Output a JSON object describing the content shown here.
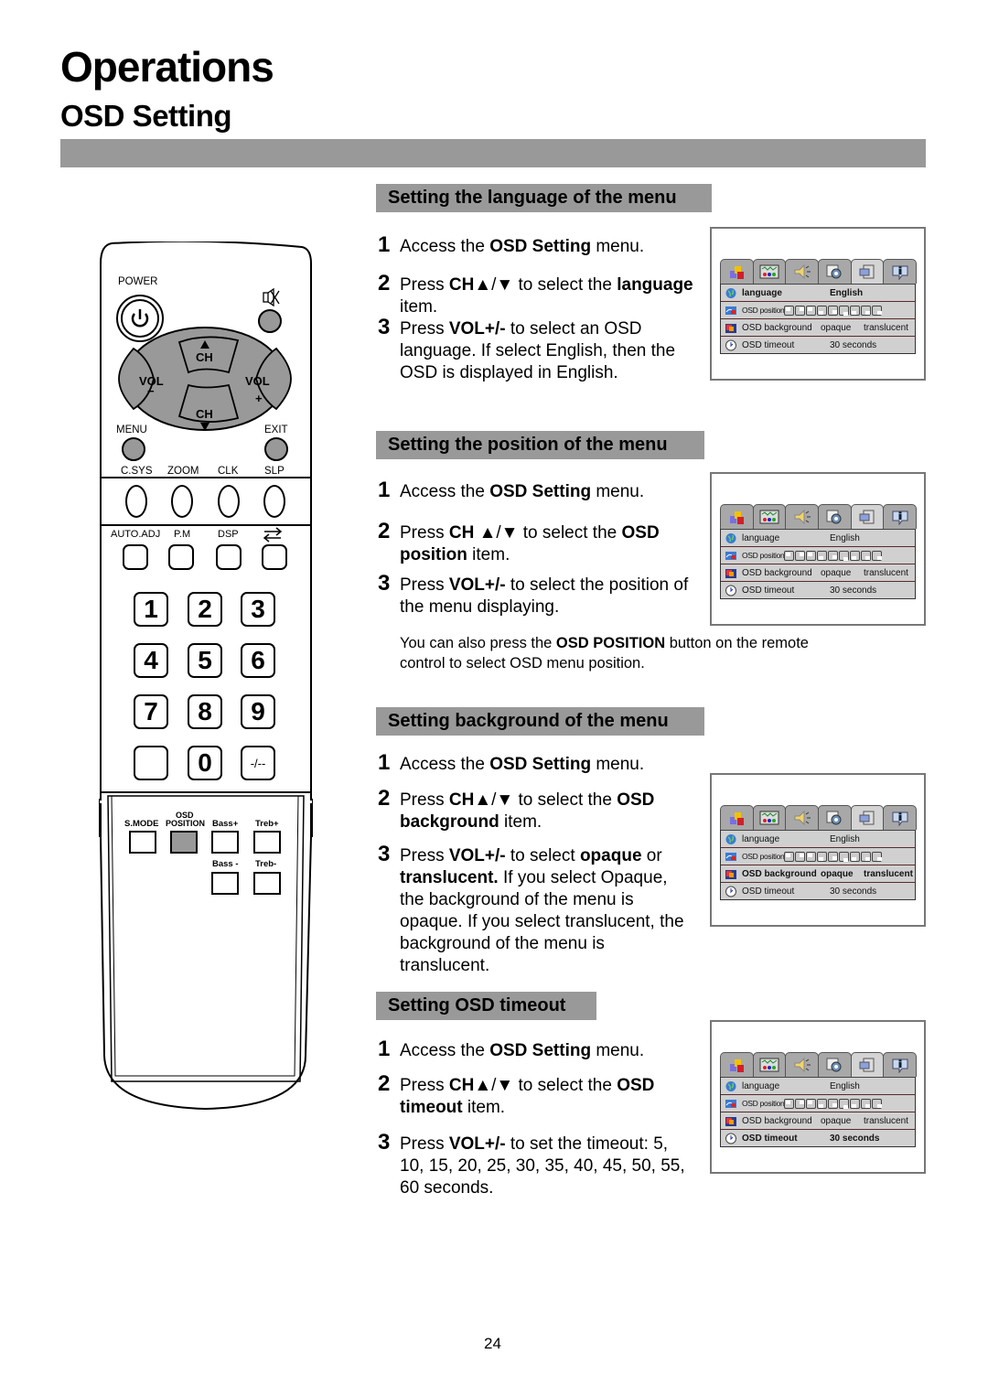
{
  "page": {
    "title": "Operations",
    "subtitle": "OSD Setting",
    "page_number": "24"
  },
  "remote": {
    "power_label": "POWER",
    "ch_label": "CH",
    "vol_label": "VOL",
    "vol_minus": "−",
    "vol_plus": "+",
    "menu_label": "MENU",
    "exit_label": "EXIT",
    "row1_labels": [
      "C.SYS",
      "ZOOM",
      "CLK",
      "SLP"
    ],
    "row2_labels": [
      "AUTO.ADJ",
      "P.M",
      "DSP"
    ],
    "digits": [
      "1",
      "2",
      "3",
      "4",
      "5",
      "6",
      "7",
      "8",
      "9",
      "0"
    ],
    "dash_label": "-/--",
    "bottom_labels": {
      "smode": "S.MODE",
      "osd_top": "OSD",
      "osd_bottom": "POSITION",
      "bass_plus": "Bass+",
      "treb_plus": "Treb+",
      "bass_minus": "Bass -",
      "treb_minus": "Treb-"
    }
  },
  "sections": [
    {
      "heading": "Setting the language of the menu",
      "steps": [
        {
          "n": "1",
          "parts": [
            [
              "Access the ",
              false
            ],
            [
              "OSD Setting",
              true
            ],
            [
              " menu.",
              false
            ]
          ]
        },
        {
          "n": "2",
          "parts": [
            [
              "Press ",
              false
            ],
            [
              "CH",
              true
            ],
            [
              "▲/▼",
              false
            ],
            [
              " to select the ",
              false
            ],
            [
              "language",
              true
            ],
            [
              " item.",
              false
            ]
          ]
        },
        {
          "n": "3",
          "parts": [
            [
              "Press ",
              false
            ],
            [
              "VOL+/-",
              true
            ],
            [
              " to select an OSD language. If select English, then the OSD is displayed in English.",
              false
            ]
          ]
        }
      ],
      "osd_selected": "language"
    },
    {
      "heading": "Setting the position of the menu",
      "steps": [
        {
          "n": "1",
          "parts": [
            [
              "Access the ",
              false
            ],
            [
              "OSD Setting",
              true
            ],
            [
              " menu.",
              false
            ]
          ]
        },
        {
          "n": "2",
          "parts": [
            [
              "Press ",
              false
            ],
            [
              "CH ",
              true
            ],
            [
              "▲/▼",
              false
            ],
            [
              " to select the ",
              false
            ],
            [
              "OSD position",
              true
            ],
            [
              " item.",
              false
            ]
          ]
        },
        {
          "n": "3",
          "parts": [
            [
              "Press ",
              false
            ],
            [
              "VOL+/-",
              true
            ],
            [
              " to select the position of the menu displaying.",
              false
            ]
          ]
        }
      ],
      "note_parts": [
        [
          "You can also press the ",
          false
        ],
        [
          "OSD POSITION",
          true
        ],
        [
          " button on the remote control to select OSD menu position.",
          false
        ]
      ],
      "osd_selected": "none"
    },
    {
      "heading": "Setting background of the menu",
      "steps": [
        {
          "n": "1",
          "parts": [
            [
              "Access the ",
              false
            ],
            [
              "OSD Setting",
              true
            ],
            [
              " menu.",
              false
            ]
          ]
        },
        {
          "n": "2",
          "parts": [
            [
              "Press ",
              false
            ],
            [
              "CH",
              true
            ],
            [
              "▲/▼",
              false
            ],
            [
              "  to select the ",
              false
            ],
            [
              "OSD background",
              true
            ],
            [
              " item.",
              false
            ]
          ]
        },
        {
          "n": "3",
          "parts": [
            [
              "Press ",
              false
            ],
            [
              "VOL+/-",
              true
            ],
            [
              " to select ",
              false
            ],
            [
              "opaque",
              true
            ],
            [
              " or ",
              false
            ],
            [
              "translucent.",
              true
            ],
            [
              " If you select Opaque, the background of the menu is opaque. If you select translucent, the background of the menu is translucent.",
              false
            ]
          ]
        }
      ],
      "osd_selected": "background"
    },
    {
      "heading": "Setting OSD timeout",
      "steps": [
        {
          "n": "1",
          "parts": [
            [
              "Access the ",
              false
            ],
            [
              "OSD Setting",
              true
            ],
            [
              " menu.",
              false
            ]
          ]
        },
        {
          "n": "2",
          "parts": [
            [
              "Press ",
              false
            ],
            [
              "CH",
              true
            ],
            [
              "▲/▼",
              false
            ],
            [
              "  to select the ",
              false
            ],
            [
              "OSD timeout",
              true
            ],
            [
              " item.",
              false
            ]
          ]
        },
        {
          "n": "3",
          "parts": [
            [
              "Press ",
              false
            ],
            [
              "VOL+/-",
              true
            ],
            [
              " to set the timeout: 5, 10, 15, 20, 25, 30, 35, 40, 45, 50, 55, 60 seconds.",
              false
            ]
          ]
        }
      ],
      "osd_selected": "timeout"
    }
  ],
  "osd_menu": {
    "tabs": [
      "picture-icon",
      "screen-icon",
      "sound-icon",
      "function-icon",
      "osd-icon",
      "info-icon"
    ],
    "active_tab": 4,
    "rows": {
      "language": {
        "label": "language",
        "value": "English"
      },
      "position": {
        "label": "OSD position",
        "positions": 9
      },
      "background": {
        "label": "OSD background",
        "opt1": "opaque",
        "opt2": "translucent"
      },
      "timeout": {
        "label": "OSD timeout",
        "value": "30 seconds"
      }
    }
  }
}
